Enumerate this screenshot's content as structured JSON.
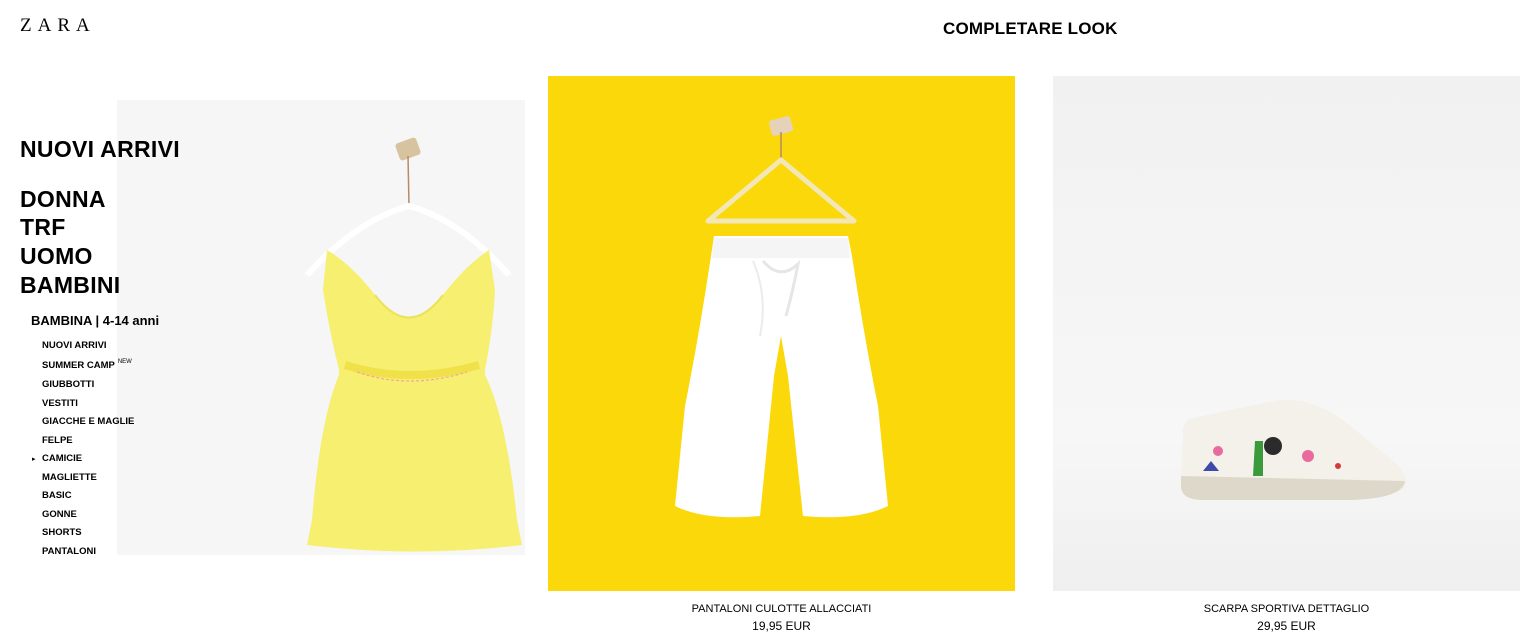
{
  "brand": {
    "logo": "ZARA"
  },
  "section": {
    "title": "COMPLETARE LOOK"
  },
  "nav": {
    "main": [
      "NUOVI ARRIVI",
      "DONNA",
      "TRF",
      "UOMO",
      "BAMBINI"
    ],
    "subcategory": "BAMBINA | 4-14 anni",
    "items": [
      {
        "label": "NUOVI ARRIVI"
      },
      {
        "label": "SUMMER CAMP",
        "badge": "NEW"
      },
      {
        "label": "GIUBBOTTI"
      },
      {
        "label": "VESTITI"
      },
      {
        "label": "GIACCHE E MAGLIE"
      },
      {
        "label": "FELPE"
      },
      {
        "label": "CAMICIE",
        "active": true
      },
      {
        "label": "MAGLIETTE"
      },
      {
        "label": "BASIC"
      },
      {
        "label": "GONNE"
      },
      {
        "label": "SHORTS"
      },
      {
        "label": "PANTALONI"
      }
    ],
    "active_marker": "▸"
  },
  "products": [
    {
      "name": "PANTALONI CULOTTE ALLACCIATI",
      "price": "19,95 EUR",
      "background": "#fbd80a"
    },
    {
      "name": "SCARPA SPORTIVA DETTAGLIO",
      "price": "29,95 EUR",
      "background": "#f3f3f3"
    }
  ],
  "colors": {
    "hero_top": "#f4ef6a",
    "pants": "#ffffff",
    "shoe": "#f2efe6"
  }
}
